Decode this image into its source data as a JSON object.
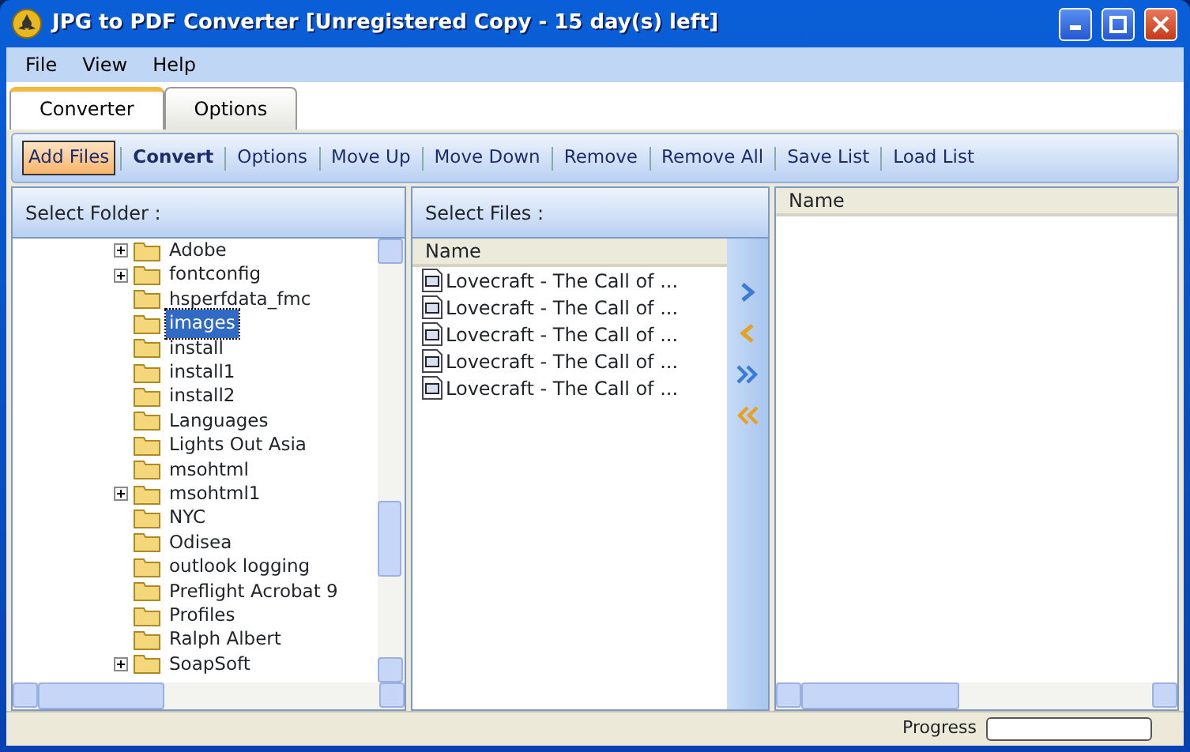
{
  "window": {
    "title": "JPG to PDF Converter [Unregistered Copy - 15 day(s) left]"
  },
  "menu": [
    "File",
    "View",
    "Help"
  ],
  "tabs": [
    {
      "label": "Converter",
      "selected": true
    },
    {
      "label": "Options",
      "selected": false
    }
  ],
  "toolbar": [
    {
      "label": "Add Files",
      "bold": false,
      "selected": true
    },
    {
      "label": "Convert",
      "bold": true,
      "selected": false
    },
    {
      "label": "Options",
      "bold": false,
      "selected": false
    },
    {
      "label": "Move Up",
      "bold": false,
      "selected": false
    },
    {
      "label": "Move Down",
      "bold": false,
      "selected": false
    },
    {
      "label": "Remove",
      "bold": false,
      "selected": false
    },
    {
      "label": "Remove All",
      "bold": false,
      "selected": false
    },
    {
      "label": "Save List",
      "bold": false,
      "selected": false
    },
    {
      "label": "Load List",
      "bold": false,
      "selected": false
    }
  ],
  "folder_panel": {
    "title": "Select Folder :",
    "tree": [
      {
        "label": "Adobe",
        "expandable": true,
        "selected": false
      },
      {
        "label": "fontconfig",
        "expandable": true,
        "selected": false
      },
      {
        "label": "hsperfdata_fmc",
        "expandable": false,
        "selected": false
      },
      {
        "label": "images",
        "expandable": false,
        "selected": true
      },
      {
        "label": "install",
        "expandable": false,
        "selected": false
      },
      {
        "label": "install1",
        "expandable": false,
        "selected": false
      },
      {
        "label": "install2",
        "expandable": false,
        "selected": false
      },
      {
        "label": "Languages",
        "expandable": false,
        "selected": false
      },
      {
        "label": "Lights Out Asia",
        "expandable": false,
        "selected": false
      },
      {
        "label": "msohtml",
        "expandable": false,
        "selected": false
      },
      {
        "label": "msohtml1",
        "expandable": true,
        "selected": false
      },
      {
        "label": "NYC",
        "expandable": false,
        "selected": false
      },
      {
        "label": "Odisea",
        "expandable": false,
        "selected": false
      },
      {
        "label": "outlook logging",
        "expandable": false,
        "selected": false
      },
      {
        "label": "Preflight Acrobat 9",
        "expandable": false,
        "selected": false
      },
      {
        "label": "Profiles",
        "expandable": false,
        "selected": false
      },
      {
        "label": "Ralph Albert",
        "expandable": false,
        "selected": false
      },
      {
        "label": "SoapSoft",
        "expandable": true,
        "selected": false
      }
    ]
  },
  "files_panel": {
    "title": "Select Files :",
    "column": "Name",
    "files": [
      "Lovecraft - The Call of ...",
      "Lovecraft - The Call of ...",
      "Lovecraft - The Call of ...",
      "Lovecraft - The Call of ...",
      "Lovecraft - The Call of ..."
    ]
  },
  "output_panel": {
    "column": "Name"
  },
  "status_bar": {
    "label": "Progress",
    "level": 0
  }
}
